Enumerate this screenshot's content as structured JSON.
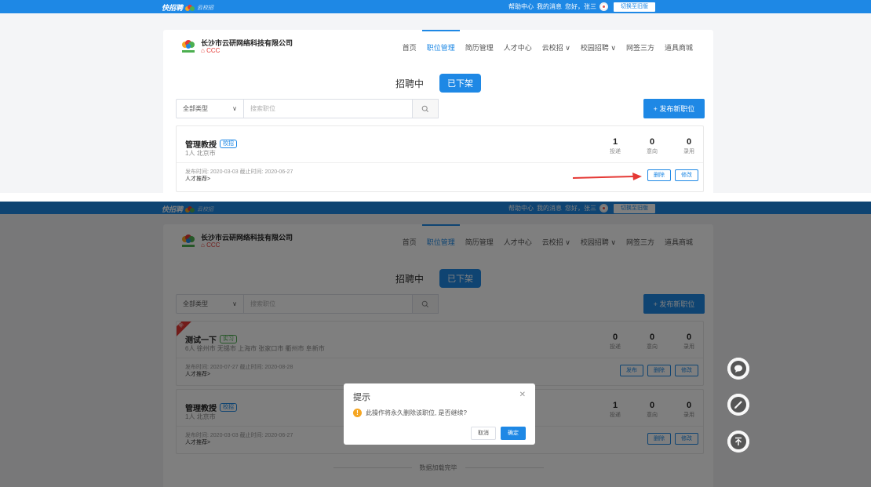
{
  "header": {
    "logo_text": "快招聘",
    "logo_sub": "云校招",
    "links": [
      "帮助中心",
      "我的消息",
      "您好，张三"
    ],
    "switch_label": "切换至旧版"
  },
  "company": {
    "name": "长沙市云研网络科技有限公司",
    "sub": "CCC"
  },
  "nav": [
    "首页",
    "职位管理",
    "简历管理",
    "人才中心",
    "云校招 ∨",
    "校园招聘 ∨",
    "网签三方",
    "道具商城"
  ],
  "status_tabs": {
    "recruiting": "招聘中",
    "offline": "已下架"
  },
  "filter": {
    "type": "全部类型",
    "placeholder": "搜索职位"
  },
  "publish_label": "+ 发布新职位",
  "stat_labels": [
    "投递",
    "意向",
    "录用"
  ],
  "talent_label": "人才推荐>",
  "shot1_job": {
    "title": "管理教授",
    "tag": "校招",
    "meta": "1人 北京市",
    "dates": "发布时间: 2020-03-03    截止时间: 2020-06-27",
    "stats": [
      "1",
      "0",
      "0"
    ],
    "actions": [
      "删除",
      "修改"
    ]
  },
  "shot2_jobs": [
    {
      "ribbon": "新",
      "title": "测试一下",
      "tag": "实习",
      "meta": "6人 徐州市 无锡市 上海市 张家口市 衢州市 阜新市",
      "dates": "发布时间: 2020-07-27    截止时间: 2020-08-28",
      "stats": [
        "0",
        "0",
        "0"
      ],
      "actions": [
        "发布",
        "删除",
        "修改"
      ]
    },
    {
      "title": "管理教授",
      "tag": "校招",
      "meta": "1人 北京市",
      "dates": "发布时间: 2020-03-03    截止时间: 2020-06-27",
      "stats": [
        "1",
        "0",
        "0"
      ],
      "actions": [
        "删除",
        "修改"
      ]
    }
  ],
  "loaded_text": "数据加载完毕",
  "dialog": {
    "title": "提示",
    "message": "此操作将永久删除该职位, 是否继续?",
    "cancel": "取消",
    "confirm": "确定"
  },
  "colors": {
    "primary": "#1e88e5",
    "danger": "#e53935",
    "warning": "#f5a623"
  }
}
